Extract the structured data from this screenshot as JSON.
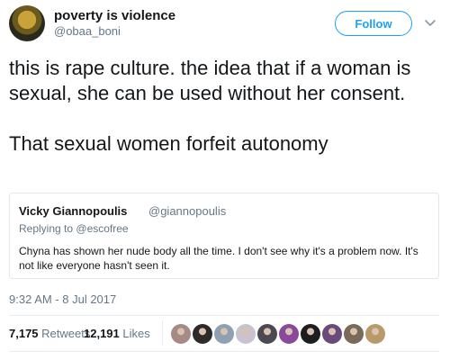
{
  "author": {
    "name": "poverty is violence",
    "handle": "@obaa_boni",
    "follow_label": "Follow"
  },
  "tweet_text": "this is rape culture. the idea that if a woman is sexual, she can be used without her consent.\n\nThat sexual women forfeit autonomy",
  "quoted_tweet": {
    "name": "Vicky Giannopoulis",
    "handle": "@giannopoulis",
    "replying_label": "Replying to",
    "replying_to": "@escofree",
    "text": "Chyna has shown her nude body all the time.  I don't see why it's a problem now.   It's not like everyone hasn't seen it."
  },
  "timestamp": "9:32 AM - 8 Jul 2017",
  "stats": {
    "retweets_count": "7,175",
    "retweets_label": "Retweets",
    "likes_count": "12,191",
    "likes_label": "Likes"
  },
  "liker_avatar_colors": [
    "#a58a86",
    "#2f2a2a",
    "#8fa0b3",
    "#c9c2cf",
    "#4a4a52",
    "#8a4a9c",
    "#1e1e1e",
    "#6a4a7a",
    "#7a6a5a",
    "#b89a6a"
  ],
  "icons": {
    "more": "chevron-down-icon"
  }
}
